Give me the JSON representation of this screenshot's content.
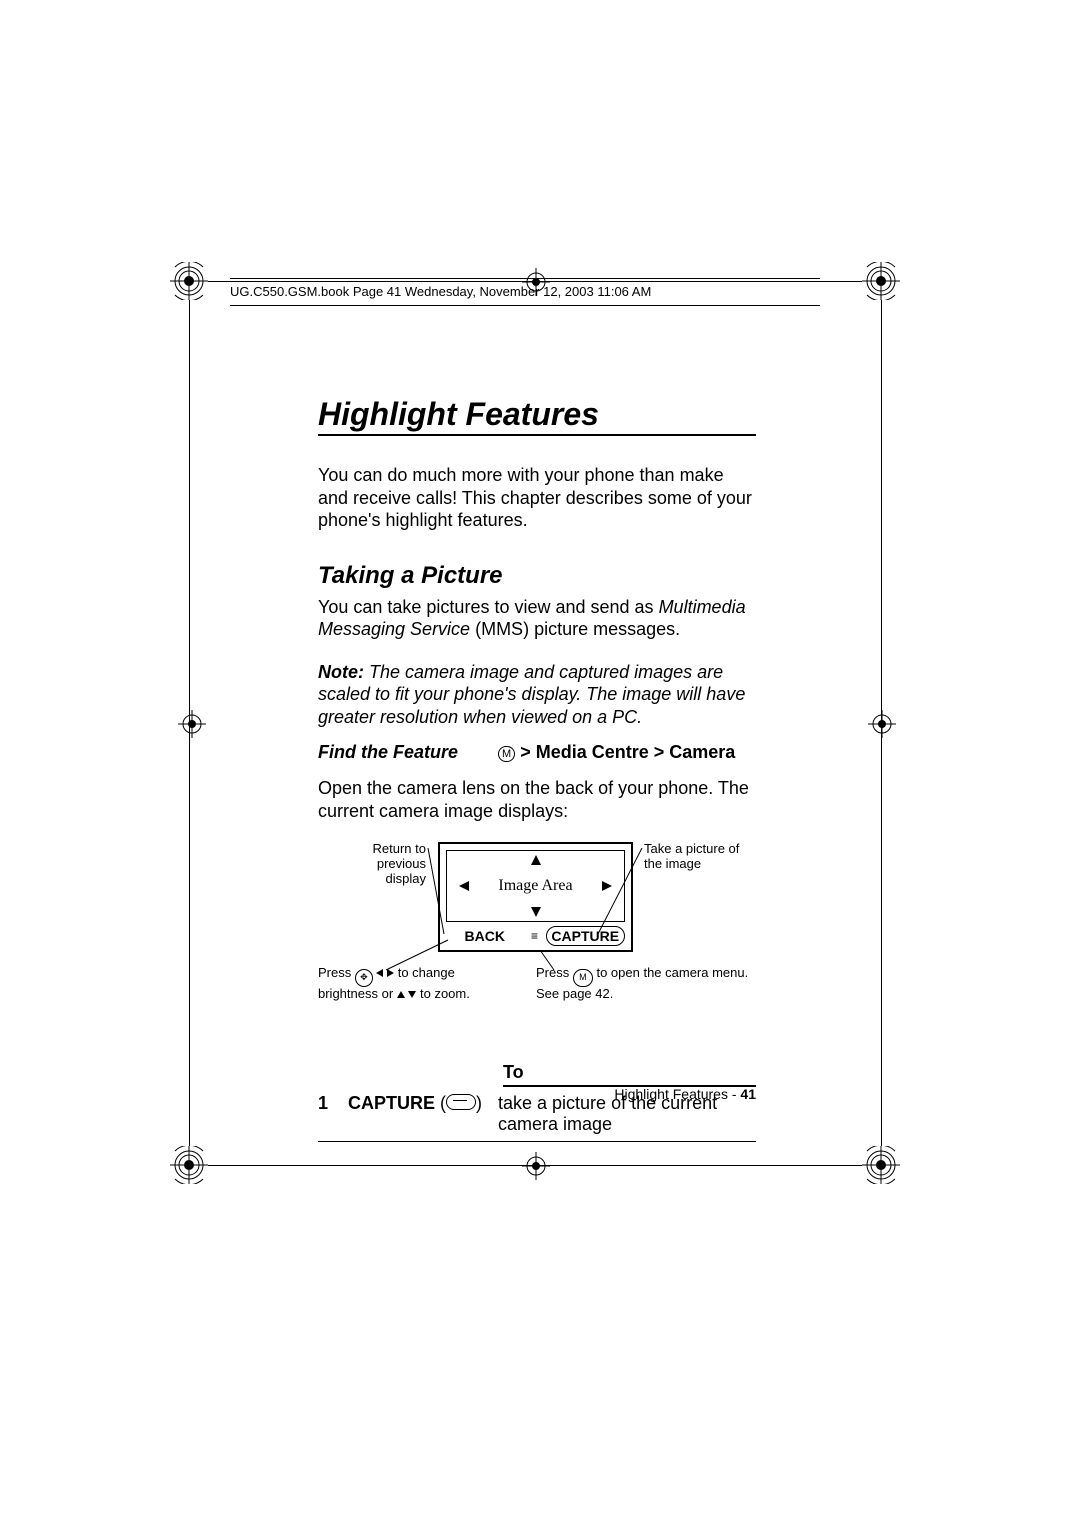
{
  "header": "UG.C550.GSM.book  Page 41  Wednesday, November 12, 2003  11:06 AM",
  "title": "Highlight Features",
  "intro": "You can do much more with your phone than make and receive calls! This chapter describes some of your phone's highlight features.",
  "section": "Taking a Picture",
  "p1a": "You can take pictures to view and send as ",
  "p1b": "Multimedia Messaging Service",
  "p1c": " (MMS) picture messages.",
  "note_lead": "Note: ",
  "note_body": "The camera image and captured images are scaled to fit your phone's display. The image will have greater resolution when viewed on a PC.",
  "find_label": "Find the Feature",
  "find_menu": "M",
  "find_path": " > Media Centre > Camera",
  "p2": "Open the camera lens on the back of your phone. The current camera image displays:",
  "diag": {
    "center": "Image Area",
    "back": "BACK",
    "capture": "CAPTURE",
    "lbl_left": "Return to previous display",
    "lbl_right": "Take a picture of the image",
    "lbl_bl_a": "Press ",
    "lbl_bl_b": " to change brightness or ",
    "lbl_bl_c": " to zoom.",
    "lbl_br_a": "Press ",
    "lbl_br_b": " to open the camera menu. See page 42."
  },
  "step_head": "To",
  "step_num": "1",
  "step_action": "CAPTURE",
  "step_desc": "take a picture of the current camera image",
  "footer_text": "Highlight Features - ",
  "footer_page": "41"
}
